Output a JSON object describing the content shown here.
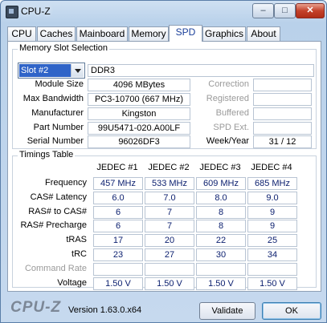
{
  "window": {
    "title": "CPU-Z"
  },
  "titlebar": {
    "minimize": "–",
    "maximize": "□",
    "close": "✕"
  },
  "tabs": [
    {
      "label": "CPU"
    },
    {
      "label": "Caches"
    },
    {
      "label": "Mainboard"
    },
    {
      "label": "Memory"
    },
    {
      "label": "SPD"
    },
    {
      "label": "Graphics"
    },
    {
      "label": "About"
    }
  ],
  "slot": {
    "title": "Memory Slot Selection",
    "selected": "Slot #2",
    "type": "DDR3",
    "module_size_label": "Module Size",
    "module_size": "4096 MBytes",
    "max_bandwidth_label": "Max Bandwidth",
    "max_bandwidth": "PC3-10700 (667 MHz)",
    "manufacturer_label": "Manufacturer",
    "manufacturer": "Kingston",
    "part_number_label": "Part Number",
    "part_number": "99U5471-020.A00LF",
    "serial_number_label": "Serial Number",
    "serial_number": "96026DF3",
    "correction_label": "Correction",
    "correction": "",
    "registered_label": "Registered",
    "registered": "",
    "buffered_label": "Buffered",
    "buffered": "",
    "spd_ext_label": "SPD Ext.",
    "spd_ext": "",
    "week_year_label": "Week/Year",
    "week_year": "31 / 12"
  },
  "timings": {
    "title": "Timings Table",
    "columns": [
      "JEDEC #1",
      "JEDEC #2",
      "JEDEC #3",
      "JEDEC #4"
    ],
    "rows": [
      {
        "label": "Frequency",
        "values": [
          "457 MHz",
          "533 MHz",
          "609 MHz",
          "685 MHz"
        ]
      },
      {
        "label": "CAS# Latency",
        "values": [
          "6.0",
          "7.0",
          "8.0",
          "9.0"
        ]
      },
      {
        "label": "RAS# to CAS#",
        "values": [
          "6",
          "7",
          "8",
          "9"
        ]
      },
      {
        "label": "RAS# Precharge",
        "values": [
          "6",
          "7",
          "8",
          "9"
        ]
      },
      {
        "label": "tRAS",
        "values": [
          "17",
          "20",
          "22",
          "25"
        ]
      },
      {
        "label": "tRC",
        "values": [
          "23",
          "27",
          "30",
          "34"
        ]
      },
      {
        "label": "Command Rate",
        "values": [
          "",
          "",
          "",
          ""
        ]
      },
      {
        "label": "Voltage",
        "values": [
          "1.50 V",
          "1.50 V",
          "1.50 V",
          "1.50 V"
        ]
      }
    ]
  },
  "footer": {
    "logo": "CPU-Z",
    "version": "Version 1.63.0.x64",
    "validate": "Validate",
    "ok": "OK"
  },
  "colors": {
    "active_tab_text": "#1a3f9a",
    "selection": "#2f64c8",
    "value_text": "#0a1e6e"
  }
}
